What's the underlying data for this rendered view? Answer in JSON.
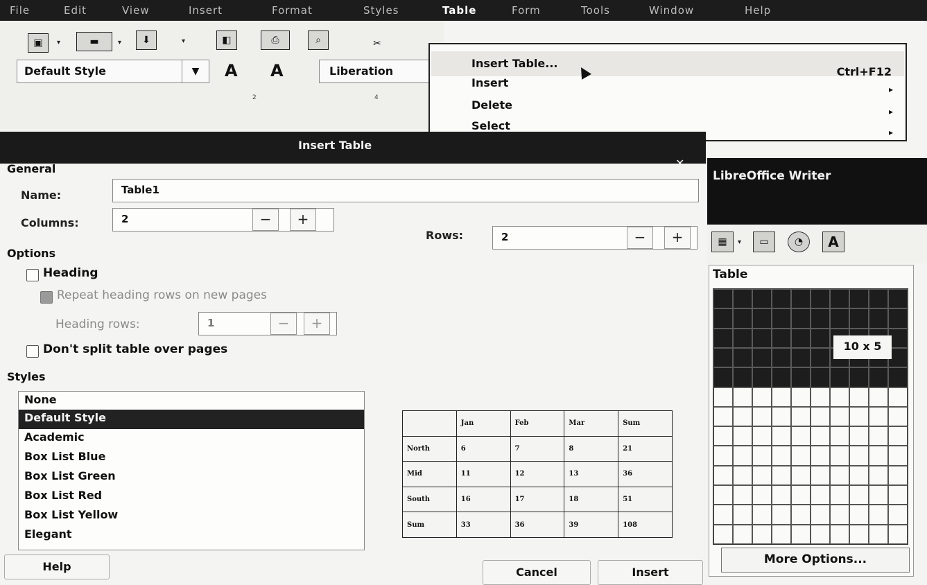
{
  "menubar": {
    "items": [
      "File",
      "Edit",
      "View",
      "Insert",
      "Format",
      "Styles",
      "Table",
      "Form",
      "Tools",
      "Window",
      "Help"
    ],
    "active": "Table"
  },
  "toolbar": {
    "paragraph_style": "Default Style",
    "font_name": "Liberation",
    "ruler_marks": [
      "2",
      "4"
    ]
  },
  "table_menu": {
    "items": [
      {
        "label": "Insert Table...",
        "shortcut": "Ctrl+F12",
        "has_submenu": false
      },
      {
        "label": "Insert",
        "shortcut": "",
        "has_submenu": true
      },
      {
        "label": "Delete",
        "shortcut": "",
        "has_submenu": true
      },
      {
        "label": "Select",
        "shortcut": "",
        "has_submenu": true
      }
    ]
  },
  "dialog": {
    "title": "Insert Table",
    "general": {
      "heading": "General",
      "name_label": "Name:",
      "name_value": "Table1",
      "columns_label": "Columns:",
      "columns_value": "2",
      "rows_label": "Rows:",
      "rows_value": "2"
    },
    "options": {
      "heading": "Options",
      "heading_checkbox": "Heading",
      "repeat_heading": "Repeat heading rows on new pages",
      "heading_rows_label": "Heading rows:",
      "heading_rows_value": "1",
      "dont_split": "Don't split table over pages"
    },
    "styles": {
      "heading": "Styles",
      "items": [
        "None",
        "Default Style",
        "Academic",
        "Box List Blue",
        "Box List Green",
        "Box List Red",
        "Box List Yellow",
        "Elegant"
      ],
      "selected": "Default Style"
    },
    "preview": {
      "header": [
        "",
        "Jan",
        "Feb",
        "Mar",
        "Sum"
      ],
      "rows": [
        [
          "North",
          "6",
          "7",
          "8",
          "21"
        ],
        [
          "Mid",
          "11",
          "12",
          "13",
          "36"
        ],
        [
          "South",
          "16",
          "17",
          "18",
          "51"
        ],
        [
          "Sum",
          "33",
          "36",
          "39",
          "108"
        ]
      ]
    },
    "buttons": {
      "help": "Help",
      "cancel": "Cancel",
      "insert": "Insert"
    }
  },
  "right_panel": {
    "app_title": "LibreOffice Writer",
    "popup_title": "Table",
    "grid_size": "10 x 5",
    "grid_cols": 10,
    "grid_rows": 13,
    "selected_cols": 10,
    "selected_rows": 5,
    "more_options": "More Options..."
  },
  "icons": {
    "spin_minus": "−",
    "spin_plus": "+",
    "close": "✕",
    "submenu_arrow": "▸",
    "dropdown": "▾"
  }
}
